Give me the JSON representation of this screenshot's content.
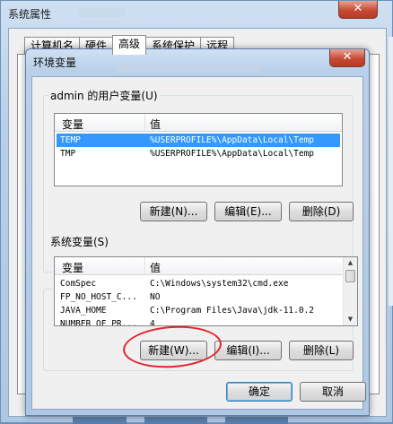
{
  "system_properties": {
    "title": "系统属性",
    "close_glyph": "✕",
    "tabs": [
      {
        "label": "计算机名"
      },
      {
        "label": "硬件"
      },
      {
        "label": "高级"
      },
      {
        "label": "系统保护"
      },
      {
        "label": "远程"
      }
    ],
    "active_tab": "高级"
  },
  "env_dialog": {
    "title": "环境变量",
    "close_glyph": "✕",
    "user_vars": {
      "group_label": "admin 的用户变量(U)",
      "columns": {
        "name": "变量",
        "value": "值"
      },
      "rows": [
        {
          "name": "TEMP",
          "value": "%USERPROFILE%\\AppData\\Local\\Temp"
        },
        {
          "name": "TMP",
          "value": "%USERPROFILE%\\AppData\\Local\\Temp"
        }
      ],
      "selected_row": 0,
      "buttons": {
        "new": "新建(N)...",
        "edit": "编辑(E)...",
        "delete": "删除(D)"
      }
    },
    "system_vars": {
      "group_label": "系统变量(S)",
      "columns": {
        "name": "变量",
        "value": "值"
      },
      "rows": [
        {
          "name": "ComSpec",
          "value": "C:\\Windows\\system32\\cmd.exe"
        },
        {
          "name": "FP_NO_HOST_C...",
          "value": "NO"
        },
        {
          "name": "JAVA_HOME",
          "value": "C:\\Program Files\\Java\\jdk-11.0.2"
        },
        {
          "name": "NUMBER_OF_PR...",
          "value": "4"
        }
      ],
      "buttons": {
        "new": "新建(W)...",
        "edit": "编辑(I)...",
        "delete": "删除(L)"
      }
    },
    "ok_label": "确定",
    "cancel_label": "取消"
  },
  "colors": {
    "selection": "#3399ff",
    "annotation": "#e4232b",
    "close_button": "#c74a35"
  }
}
